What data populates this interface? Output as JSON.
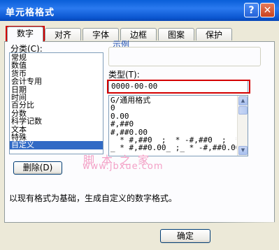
{
  "window": {
    "title": "单元格格式",
    "help_glyph": "?",
    "close_glyph": "✕"
  },
  "tabs": [
    {
      "label": "数字"
    },
    {
      "label": "对齐"
    },
    {
      "label": "字体"
    },
    {
      "label": "边框"
    },
    {
      "label": "图案"
    },
    {
      "label": "保护"
    }
  ],
  "category": {
    "label": "分类(C):",
    "items": [
      "常规",
      "数值",
      "货币",
      "会计专用",
      "日期",
      "时间",
      "百分比",
      "分数",
      "科学记数",
      "文本",
      "特殊",
      "自定义"
    ],
    "selected": "自定义"
  },
  "sample": {
    "label": "示例"
  },
  "type": {
    "label": "类型(T):",
    "value": "0000-00-00",
    "formats": [
      "G/通用格式",
      "0",
      "0.00",
      "#,##0",
      "#,##0.00",
      "_ * #,##0_ ;_ * -#,##0_ ;_ * \"",
      "_ * #,##0.00_ ;_ * -#,##0.00_ ;_"
    ]
  },
  "delete_button": "删除(D)",
  "description": "以现有格式为基础，生成自定义的数字格式。",
  "ok_button": "确定",
  "watermark": {
    "line1": "脚本之家",
    "line2": "www.jbxue.com"
  },
  "colors": {
    "title_bar": "#0a5fd8",
    "selection": "#316ac5",
    "highlight_box": "#d40000"
  }
}
